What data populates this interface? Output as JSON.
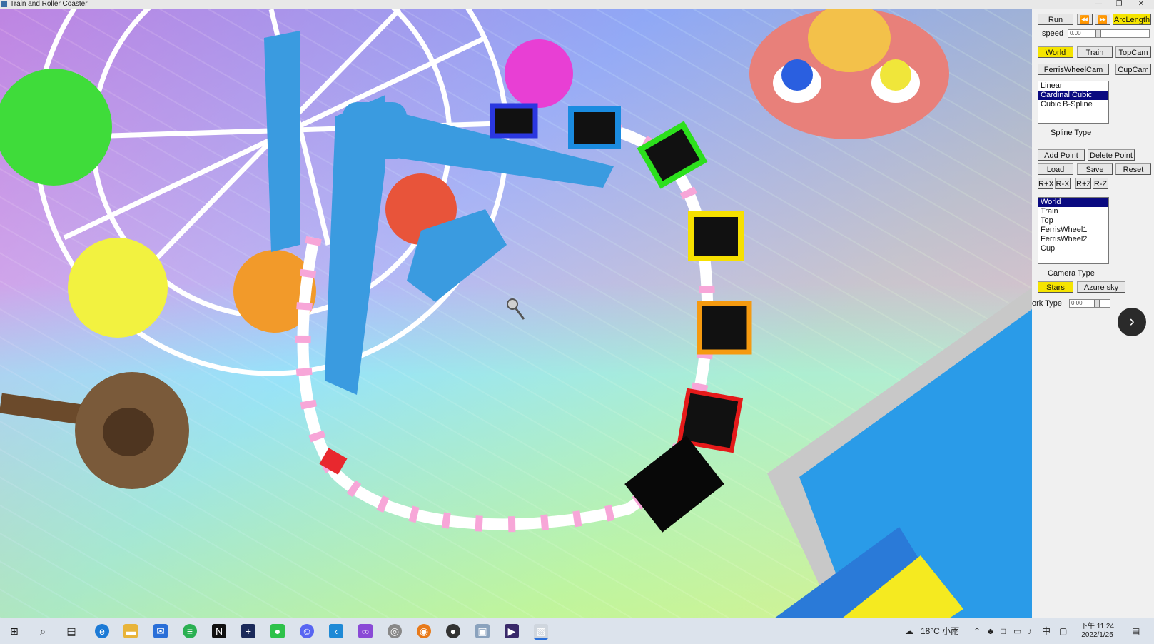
{
  "window": {
    "title": "Train and Roller Coaster",
    "controls": [
      "—",
      "❐",
      "✕"
    ]
  },
  "panel": {
    "run_label": "Run",
    "rewind_label": "⏪",
    "forward_label": "⏩",
    "arclength_label": "ArcLength",
    "speed_label": "speed",
    "speed_value": "0.00",
    "cam_buttons": {
      "world": "World",
      "train": "Train",
      "topcam": "TopCam",
      "ferris": "FerrisWheelCam",
      "cup": "CupCam"
    },
    "spline_types": [
      "Linear",
      "Cardinal Cubic",
      "Cubic B-Spline"
    ],
    "spline_selected": "Cardinal Cubic",
    "spline_label": "Spline Type",
    "edit_buttons": {
      "add": "Add Point",
      "delete": "Delete Point",
      "load": "Load",
      "save": "Save",
      "reset": "Reset",
      "rpx": "R+X",
      "rmx": "R-X",
      "rpz": "R+Z",
      "rmz": "R-Z"
    },
    "camera_types": [
      "World",
      "Train",
      "Top",
      "FerrisWheel1",
      "FerrisWheel2",
      "Cup"
    ],
    "camera_selected": "World",
    "camera_label": "Camera Type",
    "sky_buttons": {
      "stars": "Stars",
      "azure": "Azure sky"
    },
    "work_label": "ork Type",
    "work_value": "0.00"
  },
  "next_arrow": "›",
  "taskbar": {
    "weather": "18°C 小雨",
    "ime": "中",
    "time": "下午 11:24",
    "date": "2022/1/25"
  },
  "colors": {
    "panel_bg": "#f0f0f0",
    "toggle_on": "#f5e400",
    "list_select": "#0a0a80",
    "ferris_blue": "#3a9be0",
    "track_pink": "#f7a6d8"
  }
}
